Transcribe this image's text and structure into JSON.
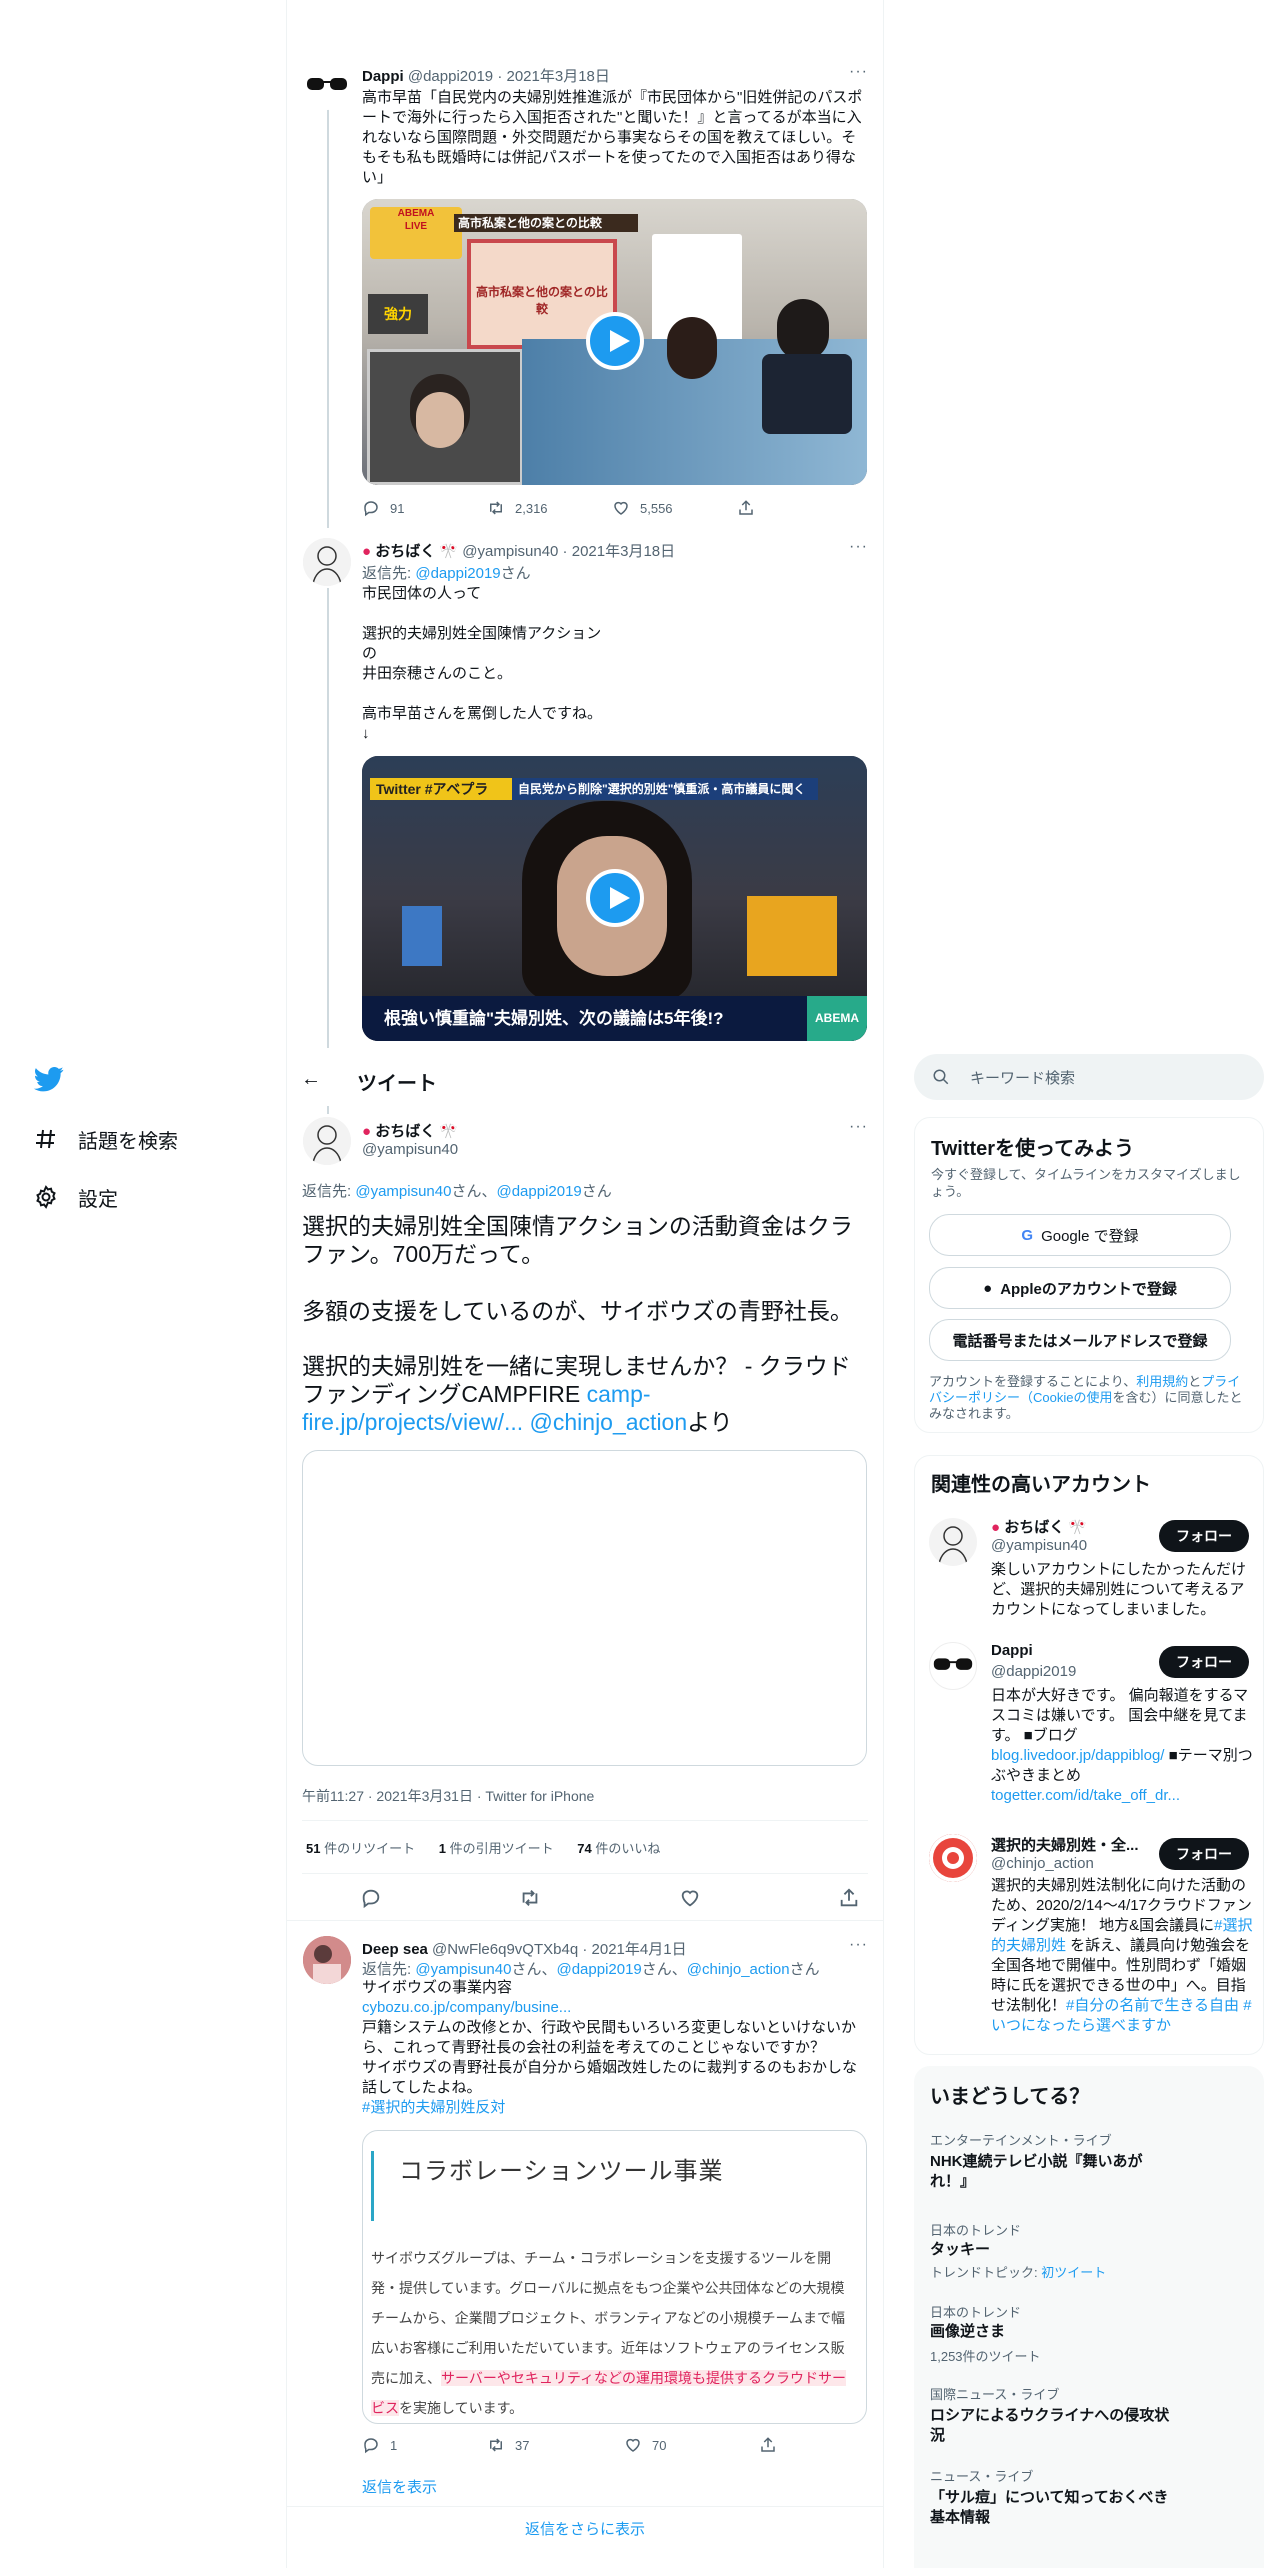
{
  "nav": {
    "explore": "話題を検索",
    "settings": "設定"
  },
  "header": {
    "title": "ツイート"
  },
  "thread": [
    {
      "name": "Dappi",
      "handle": "@dappi2019",
      "date": "2021年3月18日",
      "text": "高市早苗「自民党内の夫婦別姓推進派が『市民団体から\"旧姓併記のパスポートで海外に行ったら入国拒否された\"と聞いた！』と言ってるが本当に入れないなら国際問題・外交問題だから事実ならその国を教えてほしい。そもそも私も既婚時には併記パスポートを使ってたので入国拒否はあり得ない」",
      "replies": "91",
      "retweets": "2,316",
      "likes": "5,556",
      "media_texts": [
        "高市私案と他の案との比較",
        "強力",
        "高市私案と他の案との比較",
        "ABEMA",
        "LIVE"
      ]
    },
    {
      "name": "おちばく",
      "handle": "@yampisun40",
      "date": "2021年3月18日",
      "reply_to_label": "返信先:",
      "reply_to": "@dappi2019",
      "reply_suffix": "さん",
      "text": "市民団体の人って\n\n選択的夫婦別姓全国陳情アクション\nの\n井田奈穂さんのこと。\n\n高市早苗さんを罵倒した人ですね。\n↓",
      "media_texts": [
        "Twitter #アベプラ",
        "自民党から削除\"選択的別姓\"慎重派・高市議員に聞く",
        "根強い慎重論\"夫婦別姓、次の議論は5年後!?",
        "ABEMA news"
      ]
    }
  ],
  "main_tweet": {
    "name": "おちばく",
    "handle": "@yampisun40",
    "reply_to_label": "返信先:",
    "reply_to_1": "@yampisun40",
    "reply_to_2": "@dappi2019",
    "reply_mid": "さん、",
    "reply_suffix": "さん",
    "line1": "選択的夫婦別姓全国陳情アクションの活動資金はクラファン。700万だって。",
    "line2": "多額の支援をしているのが、サイボウズの青野社長。",
    "line3a": "選択的夫婦別姓を一緒に実現しませんか？ - クラウドファンディングCAMPFIRE ",
    "link": "camp-fire.jp/projects/view/...",
    "mention": "@chinjo_action",
    "line3b": "より",
    "meta": "午前11:27 · 2021年3月31日 · Twitter for iPhone",
    "retweets_count": "51",
    "retweets_label": "件のリツイート",
    "quotes_count": "1",
    "quotes_label": "件の引用ツイート",
    "likes_count": "74",
    "likes_label": "件のいいね"
  },
  "reply": {
    "name": "Deep sea",
    "handle": "@NwFle6q9vQTXb4q",
    "date": "2021年4月1日",
    "reply_to_label": "返信先:",
    "reply_to_1": "@yampisun40",
    "reply_to_2": "@dappi2019",
    "reply_to_3": "@chinjo_action",
    "reply_mid": "さん、",
    "reply_suffix": "さん",
    "line1": "サイボウズの事業内容",
    "link": "cybozu.co.jp/company/busine...",
    "text": "戸籍システムの改修とか、行政や民間もいろいろ変更しないといけないから、これって青野社長の会社の利益を考えてのことじゃないですか？\nサイボウズの青野社長が自分から婚姻改姓したのに裁判するのもおかしな話してしたよね。",
    "hashtag": "#選択的夫婦別姓反対",
    "card_title": "コラボレーションツール事業",
    "card_text": "サイボウズグループは、チーム・コラボレーションを支援するツールを開発・提供しています。グローバルに拠点をもつ企業や公共団体などの大規模チームから、企業間プロジェクト、ボランティアなどの小規模チームまで幅広いお客様にご利用いただいています。近年はソフトウェアのライセンス販売に加え、",
    "card_highlight": "サーバーやセキュリティなどの運用環境も提供するクラウドサービス",
    "card_end": "を実施しています。",
    "replies": "1",
    "retweets": "37",
    "likes": "70",
    "show_replies": "返信を表示",
    "show_more": "返信をさらに表示"
  },
  "search": {
    "placeholder": "キーワード検索"
  },
  "signup": {
    "title": "Twitterを使ってみよう",
    "subtitle": "今すぐ登録して、タイムラインをカスタマイズしましょう。",
    "google": "Google で登録",
    "apple": "Appleのアカウントで登録",
    "phone": "電話番号またはメールアドレスで登録",
    "terms_1": "アカウントを登録することにより、",
    "terms_link1": "利用規約",
    "terms_2": "と",
    "terms_link2": "プライバシーポリシー",
    "terms_link3": "（Cookieの使用",
    "terms_3": "を含む）に同意したとみなされます。"
  },
  "related": {
    "title": "関連性の高いアカウント",
    "follow_label": "フォロー",
    "accounts": [
      {
        "name": "おちばく",
        "handle": "@yampisun40",
        "bio": "楽しいアカウントにしたかったんだけど、選択的夫婦別姓について考えるアカウントになってしまいました。"
      },
      {
        "name": "Dappi",
        "handle": "@dappi2019",
        "bio": "日本が大好きです。 偏向報道をするマスコミは嫌いです。 国会中継を見てます。 ■ブログ",
        "link1": "blog.livedoor.jp/dappiblog/",
        "bio2": " ■テーマ別つぶやきまとめ",
        "link2": "togetter.com/id/take_off_dr..."
      },
      {
        "name": "選択的夫婦別姓・全...",
        "handle": "@chinjo_action",
        "bio": "選択的夫婦別姓法制化に向けた活動のため、2020/2/14〜4/17クラウドファンディング実施！ 地方&国会議員に",
        "tag1": "#選択的夫婦別姓",
        "bio2": " を訴え、議員向け勉強会を全国各地で開催中。性別問わず「婚姻時に氏を選択できる世の中」へ。目指せ法制化！",
        "tag2": "#自分の名前で生きる自由",
        "tag3": " #いつになったら選べますか"
      }
    ]
  },
  "trends": {
    "title": "いまどうしてる？",
    "items": [
      {
        "category": "エンターテインメント・ライブ",
        "title": "NHK連続テレビ小説『舞いあがれ！』"
      },
      {
        "category": "日本のトレンド",
        "title": "タッキー",
        "sub_label": "トレンドトピック:",
        "sub_value": "初ツイート"
      },
      {
        "category": "日本のトレンド",
        "title": "画像逆さま",
        "count": "1,253件のツイート"
      },
      {
        "category": "国際ニュース・ライブ",
        "title": "ロシアによるウクライナへの侵攻状況"
      },
      {
        "category": "ニュース・ライブ",
        "title": "「サル痘」について知っておくべき基本情報"
      }
    ]
  },
  "colors": {
    "accent": "#1d9bf0",
    "text": "#0f1419",
    "muted": "#536471",
    "highlight_bg": "#fde7ea"
  }
}
